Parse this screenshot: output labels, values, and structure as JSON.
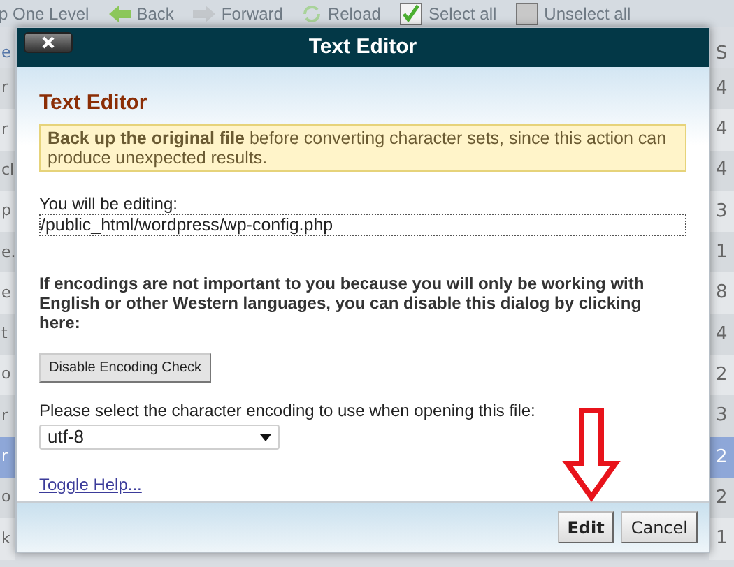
{
  "toolbar": [
    {
      "kind": "up",
      "label": "p One Level"
    },
    {
      "kind": "back",
      "label": "Back"
    },
    {
      "kind": "forward",
      "label": "Forward"
    },
    {
      "kind": "reload",
      "label": "Reload"
    },
    {
      "kind": "select",
      "label": "Select all"
    },
    {
      "kind": "unselect",
      "label": "Unselect all"
    }
  ],
  "file_list": {
    "header": {
      "column_1": "e",
      "column_2": "S"
    },
    "rows": [
      {
        "column_1": "r",
        "column_2": "4",
        "selected": false
      },
      {
        "column_1": "r",
        "column_2": "4",
        "selected": false
      },
      {
        "column_1": "cl",
        "column_2": "4",
        "selected": false
      },
      {
        "column_1": "p",
        "column_2": "3",
        "selected": false
      },
      {
        "column_1": "e.",
        "column_2": "1",
        "selected": false
      },
      {
        "column_1": "e",
        "column_2": "8",
        "selected": false
      },
      {
        "column_1": "t",
        "column_2": "4",
        "selected": false
      },
      {
        "column_1": "o",
        "column_2": "2",
        "selected": false
      },
      {
        "column_1": "r",
        "column_2": "3",
        "selected": false
      },
      {
        "column_1": "r",
        "column_2": "2",
        "selected": true
      },
      {
        "column_1": "o",
        "column_2": "2",
        "selected": false
      },
      {
        "column_1": "k",
        "column_2": "1",
        "selected": false
      }
    ]
  },
  "dialog": {
    "title": "Text Editor",
    "heading": "Text Editor",
    "warning": "**Back up the original file** before converting character sets, since this action can produce unexpected results.",
    "file_label": "You will be editing:",
    "file_path": "/public_html/wordpress/wp-config.php",
    "notice": "If encodings are not important to you because you will only be working with English or other Western languages, you can disable this dialog by clicking here:",
    "disable_button": "Disable Encoding Check",
    "encoding_label": "Please select the character encoding to use when opening this file:",
    "encoding": "utf-8",
    "help_link": "Toggle Help...",
    "buttons": [
      {
        "kind": "primary",
        "label": "Edit"
      },
      {
        "kind": "secondary",
        "label": "Cancel"
      }
    ]
  }
}
